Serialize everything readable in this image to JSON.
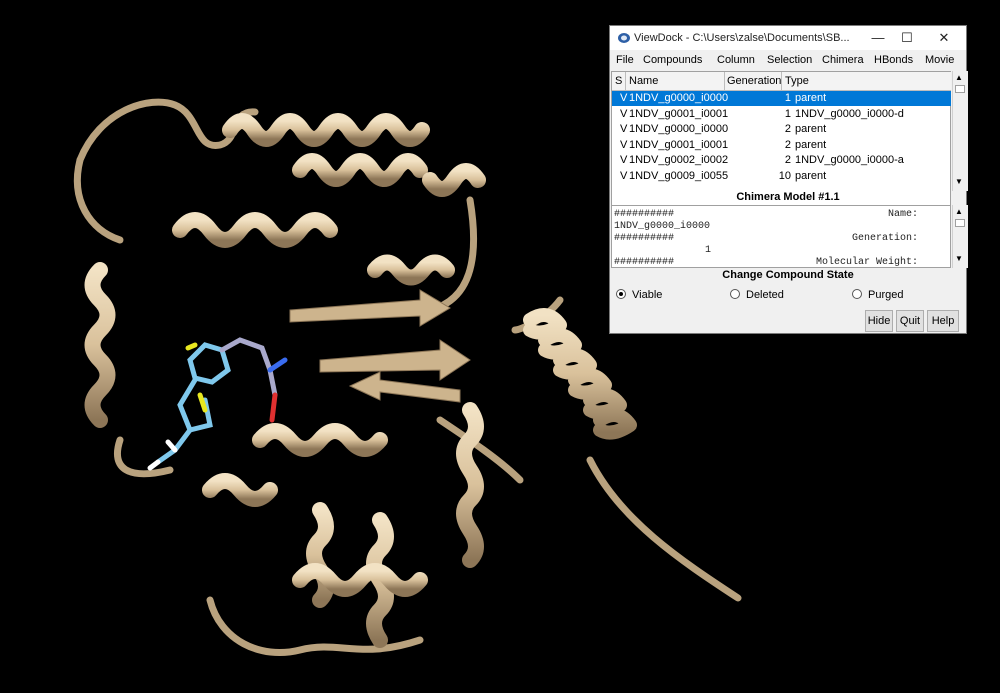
{
  "window": {
    "title": "ViewDock - C:\\Users\\zalse\\Documents\\SB...",
    "controls": {
      "minimize": "—",
      "maximize": "☐",
      "close": "✕"
    }
  },
  "menu": [
    "File",
    "Compounds",
    "Column",
    "Selection",
    "Chimera",
    "HBonds",
    "Movie"
  ],
  "table": {
    "headers": [
      "S",
      "Name",
      "Generation",
      "Type"
    ],
    "rows": [
      {
        "s": "V",
        "name": "1NDV_g0000_i0000",
        "generation": "1",
        "type": "parent",
        "selected": true
      },
      {
        "s": "V",
        "name": "1NDV_g0001_i0001",
        "generation": "1",
        "type": "1NDV_g0000_i0000-d",
        "selected": false
      },
      {
        "s": "V",
        "name": "1NDV_g0000_i0000",
        "generation": "2",
        "type": "parent",
        "selected": false
      },
      {
        "s": "V",
        "name": "1NDV_g0001_i0001",
        "generation": "2",
        "type": "parent",
        "selected": false
      },
      {
        "s": "V",
        "name": "1NDV_g0002_i0002",
        "generation": "2",
        "type": "1NDV_g0000_i0000-a",
        "selected": false
      },
      {
        "s": "V",
        "name": "1NDV_g0009_i0055",
        "generation": "10",
        "type": "parent",
        "selected": false
      }
    ]
  },
  "model_title": "Chimera Model #1.1",
  "details": {
    "line1_left": "##########",
    "line1_right": "Name:",
    "line2": "1NDV_g0000_i0000",
    "line3_left": "##########",
    "line3_right": "Generation:",
    "line4": "1",
    "line5_left": "##########",
    "line5_right": "Molecular Weight:"
  },
  "state_section": {
    "title": "Change Compound State",
    "options": [
      "Viable",
      "Deleted",
      "Purged"
    ],
    "selected": "Viable"
  },
  "buttons": {
    "hide": "Hide",
    "quit": "Quit",
    "help": "Help"
  },
  "colors": {
    "ribbon": "#d9c19b",
    "ligand_carbon": "#7fc8ec",
    "selection": "#0078d7",
    "background": "#000000"
  },
  "icons": {
    "app": "viewdock-icon"
  }
}
